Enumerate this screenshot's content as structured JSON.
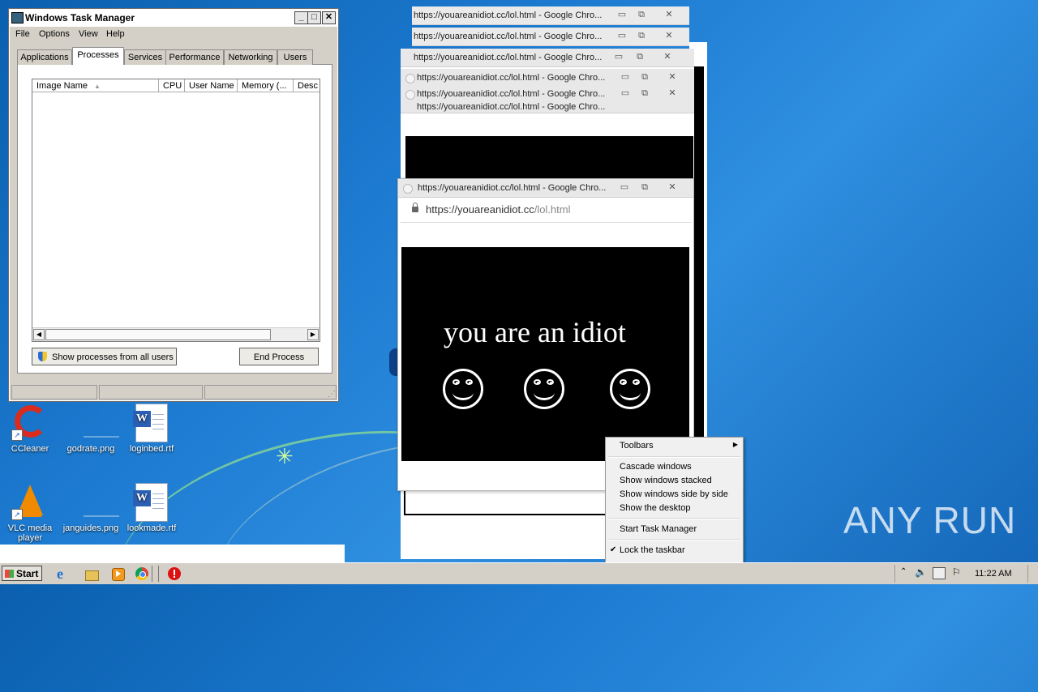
{
  "task_manager": {
    "title": "Windows Task Manager",
    "menu": [
      "File",
      "Options",
      "View",
      "Help"
    ],
    "tabs": [
      "Applications",
      "Processes",
      "Services",
      "Performance",
      "Networking",
      "Users"
    ],
    "active_tab": "Processes",
    "columns": [
      "Image Name",
      "CPU",
      "User Name",
      "Memory (...",
      "Desc"
    ],
    "show_all_label": "Show processes from all users",
    "end_process_label": "End Process"
  },
  "chrome_windows": {
    "title": "https://youareanidiot.cc/lol.html - Google Chro...",
    "url_host": "https://youareanidiot.cc",
    "url_path": "/lol.html"
  },
  "popup": {
    "message": "you are an idiot"
  },
  "context_menu": {
    "items": [
      "Toolbars",
      "Cascade windows",
      "Show windows stacked",
      "Show windows side by side",
      "Show the desktop",
      "Start Task Manager",
      "Lock the taskbar"
    ]
  },
  "desktop_icons": [
    {
      "label": "CCleaner",
      "kind": "ccleaner-icon"
    },
    {
      "label": "godrate.png",
      "kind": "image-file-icon"
    },
    {
      "label": "loginbed.rtf",
      "kind": "word-doc-icon"
    },
    {
      "label": "VLC media player",
      "kind": "vlc-icon"
    },
    {
      "label": "janguides.png",
      "kind": "image-file-icon"
    },
    {
      "label": "lookmade.rtf",
      "kind": "word-doc-icon"
    }
  ],
  "taskbar": {
    "start_label": "Start",
    "clock": "11:22 AM"
  },
  "watermark": "ANY RUN"
}
